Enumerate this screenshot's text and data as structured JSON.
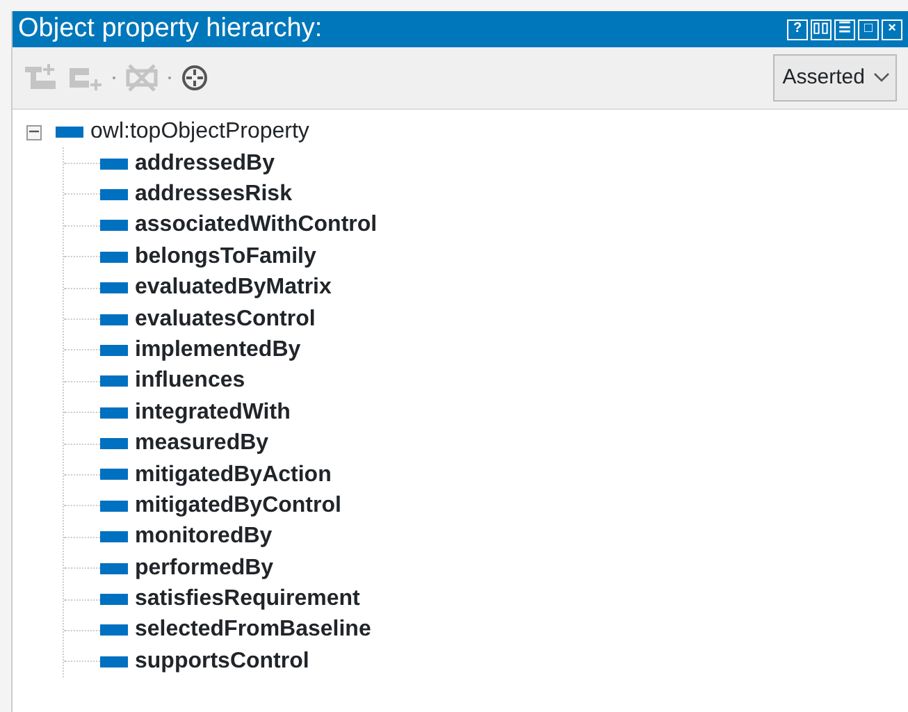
{
  "window": {
    "title": "Object property hierarchy:",
    "buttons": [
      "?",
      "▯▯",
      "☰",
      "□",
      "×"
    ]
  },
  "toolbar": {
    "tools": [
      {
        "kind": "add-sub",
        "disabled": true
      },
      {
        "kind": "add-sibling",
        "disabled": true
      },
      {
        "kind": "delete",
        "disabled": true
      },
      {
        "kind": "find",
        "disabled": false
      }
    ],
    "view_select": {
      "value": "Asserted"
    }
  },
  "tree": {
    "root": {
      "label": "owl:topObjectProperty",
      "expanded": true,
      "children": [
        {
          "label": "addressedBy"
        },
        {
          "label": "addressesRisk"
        },
        {
          "label": "associatedWithControl"
        },
        {
          "label": "belongsToFamily"
        },
        {
          "label": "evaluatedByMatrix"
        },
        {
          "label": "evaluatesControl"
        },
        {
          "label": "implementedBy"
        },
        {
          "label": "influences"
        },
        {
          "label": "integratedWith"
        },
        {
          "label": "measuredBy"
        },
        {
          "label": "mitigatedByAction"
        },
        {
          "label": "mitigatedByControl"
        },
        {
          "label": "monitoredBy"
        },
        {
          "label": "performedBy"
        },
        {
          "label": "satisfiesRequirement"
        },
        {
          "label": "selectedFromBaseline"
        },
        {
          "label": "supportsControl"
        }
      ]
    }
  }
}
